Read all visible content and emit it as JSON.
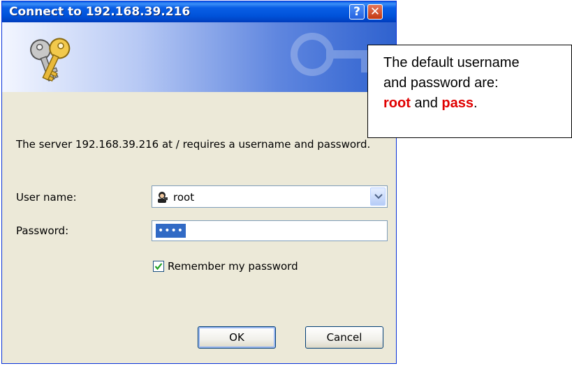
{
  "window": {
    "title": "Connect to 192.168.39.216",
    "help_icon": "question-mark-icon",
    "close_icon": "close-x-icon",
    "help_symbol": "?",
    "close_symbol": "✕"
  },
  "banner": {
    "icon": "keys-icon"
  },
  "message": "The server 192.168.39.216 at / requires a username and password.",
  "fields": {
    "username_label": "User name:",
    "username_value": "root",
    "username_icon": "user-avatar-icon",
    "password_label": "Password:",
    "password_value": "••••"
  },
  "remember": {
    "label": "Remember my password",
    "checked": true
  },
  "buttons": {
    "ok": "OK",
    "cancel": "Cancel"
  },
  "callout": {
    "line1": "The default username",
    "line2": "and password are:",
    "user": "root",
    "and": "and",
    "pass": "pass",
    "period": "."
  },
  "colors": {
    "title_bar": "#0a5fe6",
    "highlight_red": "#e00000",
    "selection": "#316ac5"
  }
}
